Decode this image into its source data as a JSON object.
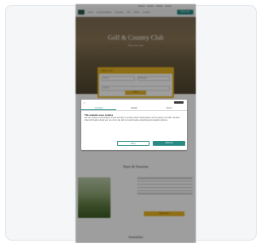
{
  "nav": {
    "links": [
      "Home",
      "Accommodation",
      "Activities",
      "Golf",
      "Offers",
      "Contact"
    ],
    "cta": "Book now"
  },
  "hero": {
    "title": "Golf & Country Club",
    "subtitle": "Plan your stay",
    "booking": {
      "heading": "Book a room",
      "field_arrival": "Arrival",
      "field_departure": "Departure",
      "field_guests": "Guests",
      "submit": "Search"
    }
  },
  "consent": {
    "close": "×",
    "tabs": [
      "Consent",
      "Details",
      "About"
    ],
    "heading": "This website uses cookies",
    "body": "We use cookies to personalise content and ads, to provide social media features and to analyse our traffic. We also share information about your use of our site with our social media, advertising and analytics partners.",
    "decline": "Deny",
    "allow": "Allow all"
  },
  "section1": {
    "title": "Stays & Sessions",
    "more": "Read more"
  },
  "section2": {
    "title": "Amenities"
  }
}
